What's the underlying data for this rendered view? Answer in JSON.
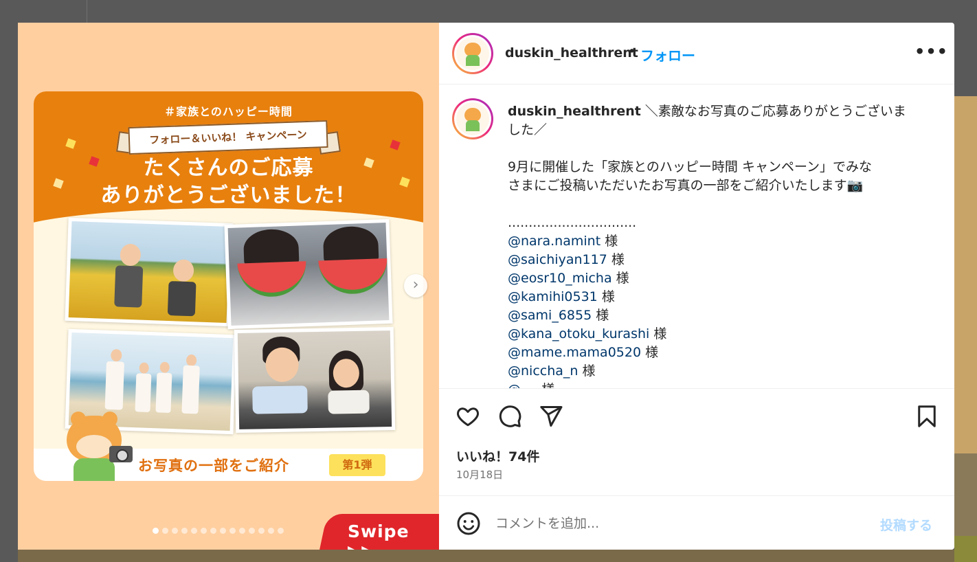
{
  "post": {
    "username": "duskin_healthrent",
    "separator": "•",
    "follow_label": "フォロー",
    "more_label": "•••",
    "caption_lines": [
      "＼素敵なお写真のご応募ありがとうございま",
      "した／",
      "",
      "9月に開催した「家族とのハッピー時間 キャンペーン」でみな",
      "さまにご投稿いただいたお写真の一部をご紹介いたします📷",
      "",
      "..............................."
    ],
    "mentions": [
      {
        "handle": "@nara.namint",
        "suffix": " 様"
      },
      {
        "handle": "@saichiyan117",
        "suffix": " 様"
      },
      {
        "handle": "@eosr10_micha",
        "suffix": " 様"
      },
      {
        "handle": "@kamihi0531",
        "suffix": " 様"
      },
      {
        "handle": "@sami_6855",
        "suffix": " 様"
      },
      {
        "handle": "@kana_otoku_kurashi",
        "suffix": " 様"
      },
      {
        "handle": "@mame.mama0520",
        "suffix": " 様"
      },
      {
        "handle": "@niccha_n",
        "suffix": " 様"
      },
      {
        "handle": "@ ...",
        "suffix": " 様"
      }
    ],
    "likes_label": "いいね！74件",
    "date_label": "10月18日",
    "comment_placeholder": "コメントを追加...",
    "post_button_label": "投稿する"
  },
  "image": {
    "hashtag": "＃家族とのハッピー時間",
    "ribbon": "フォロー＆いいね！ キャンペーン",
    "title_line1": "たくさんのご応募",
    "title_line2": "ありがとうございました！",
    "banner_text": "お写真の一部をご紹介",
    "badge": "第1弾",
    "swipe_label": "Swipe ▶▶",
    "next_arrow": "›",
    "slide_count": 14,
    "active_slide": 1
  },
  "colors": {
    "accent_blue": "#0095f6",
    "mention_blue": "#00376b",
    "card_orange": "#e8800e",
    "swipe_red": "#e0262a",
    "media_bg": "#ffcfa0"
  },
  "icons": {
    "like": "heart-icon",
    "comment": "comment-bubble-icon",
    "share": "paper-plane-icon",
    "save": "bookmark-icon",
    "emoji": "smiley-icon",
    "more": "more-options-icon"
  }
}
